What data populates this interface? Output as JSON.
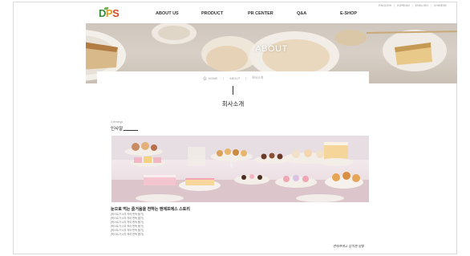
{
  "top_links": [
    "ENGLISH",
    "KOREAN",
    "ENGLISH",
    "CHINESE"
  ],
  "logo": {
    "letters": [
      "D",
      "P",
      "S"
    ]
  },
  "nav": [
    "ABOUT US",
    "PRODUCT",
    "PR CENTER",
    "Q&A",
    "E-SHOP"
  ],
  "hero": {
    "title": "ABOUT"
  },
  "breadcrumb": {
    "home": "HOME",
    "level1": "ABOUT",
    "level2": "회사소개"
  },
  "page_title": "회사소개",
  "greetings": {
    "small": "Greetings",
    "label": "인사말"
  },
  "story": {
    "title": "눈으로 먹는 즐거움을 전하는 엔에프에스 스토리",
    "lines": [
      "(텍스트가 너무 작아 판독 불가)",
      "(텍스트가 너무 작아 판독 불가)",
      "(텍스트가 너무 작아 판독 불가)",
      "(텍스트가 너무 작아 판독 불가)",
      "(텍스트가 너무 작아 판독 불가)",
      "(텍스트가 너무 작아 판독 불가)"
    ],
    "signature": "엔에프에스 임직원 일동"
  },
  "colors": {
    "logo_green": "#3a8c3a",
    "logo_orange": "#e39b1c",
    "logo_red": "#d94a2a"
  }
}
